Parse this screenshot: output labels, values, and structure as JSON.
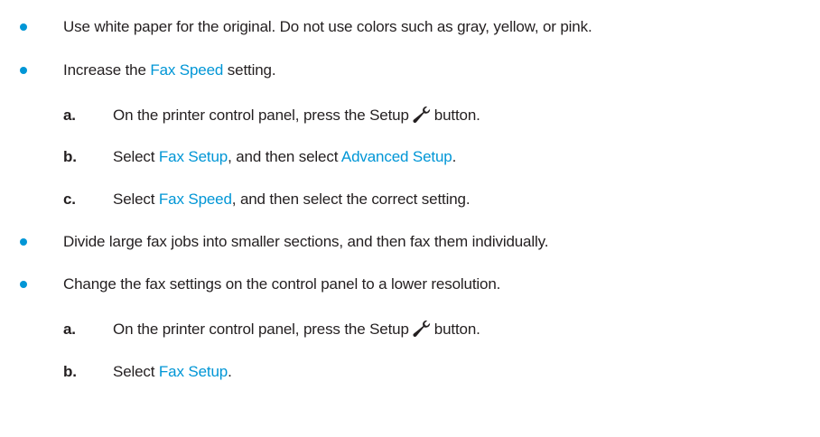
{
  "colors": {
    "text": "#231f20",
    "link": "#0096d6",
    "bullet": "#0096d6"
  },
  "items": [
    {
      "text": "Use white paper for the original. Do not use colors such as gray, yellow, or pink."
    },
    {
      "pre": "Increase the ",
      "link": "Fax Speed",
      "post": " setting.",
      "steps": [
        {
          "marker": "a.",
          "pre": "On the printer control panel, press the Setup",
          "icon": "wrench-icon",
          "post": "button."
        },
        {
          "marker": "b.",
          "pre": "Select ",
          "link1": "Fax Setup",
          "mid": ", and then select ",
          "link2": "Advanced Setup",
          "post": "."
        },
        {
          "marker": "c.",
          "pre": "Select ",
          "link1": "Fax Speed",
          "post": ", and then select the correct setting."
        }
      ]
    },
    {
      "text": "Divide large fax jobs into smaller sections, and then fax them individually."
    },
    {
      "text": "Change the fax settings on the control panel to a lower resolution.",
      "steps": [
        {
          "marker": "a.",
          "pre": "On the printer control panel, press the Setup",
          "icon": "wrench-icon",
          "post": "button."
        },
        {
          "marker": "b.",
          "pre": "Select ",
          "link1": "Fax Setup",
          "post": "."
        }
      ]
    }
  ]
}
